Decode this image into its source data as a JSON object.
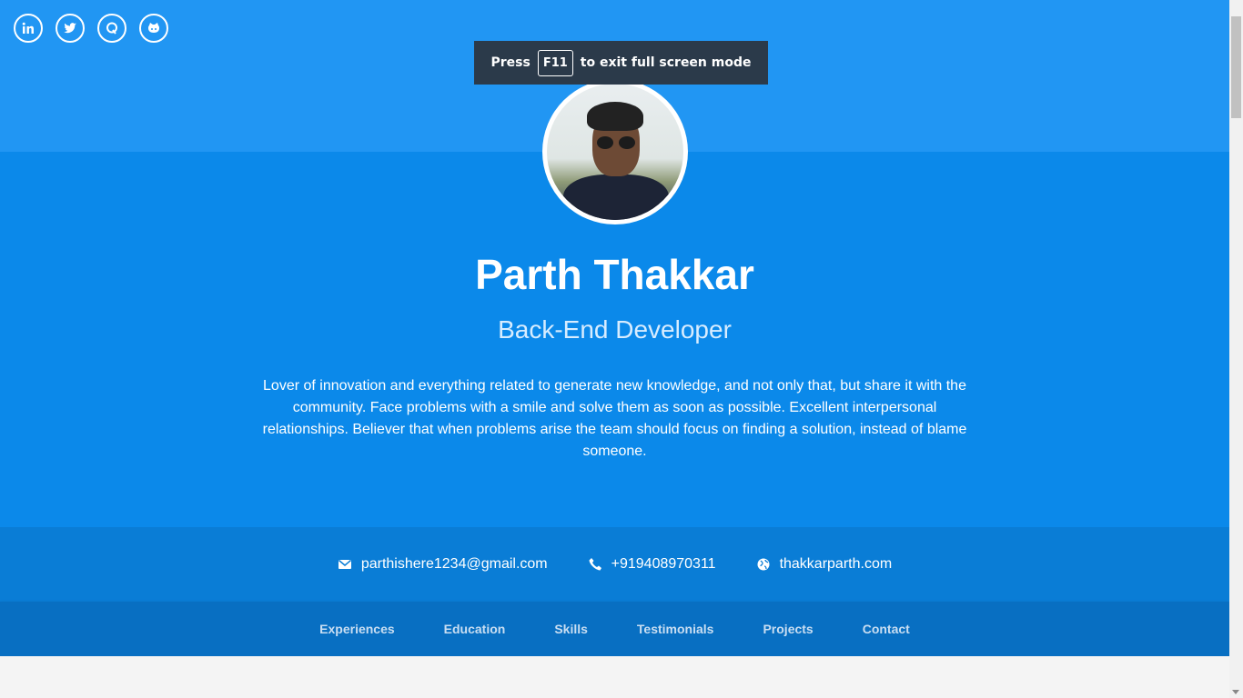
{
  "socials": [
    {
      "icon": "linkedin-icon"
    },
    {
      "icon": "twitter-icon"
    },
    {
      "icon": "quora-icon"
    },
    {
      "icon": "github-icon"
    }
  ],
  "toast": {
    "press": "Press",
    "key": "F11",
    "rest": "to exit full screen mode"
  },
  "profile": {
    "name": "Parth Thakkar",
    "role": "Back-End Developer",
    "bio": "Lover of innovation and everything related to generate new knowledge, and not only that, but share it with the community. Face problems with a smile and solve them as soon as possible. Excellent interpersonal relationships. Believer that when problems arise the team should focus on finding a solution, instead of blame someone."
  },
  "contact": {
    "email": "parthishere1234@gmail.com",
    "phone": "+919408970311",
    "website": "thakkarparth.com"
  },
  "nav": [
    "Experiences",
    "Education",
    "Skills",
    "Testimonials",
    "Projects",
    "Contact"
  ],
  "colors": {
    "top": "#2196f3",
    "hero": "#0b89ea",
    "contact": "#0a7dd6",
    "nav": "#086fc2"
  }
}
